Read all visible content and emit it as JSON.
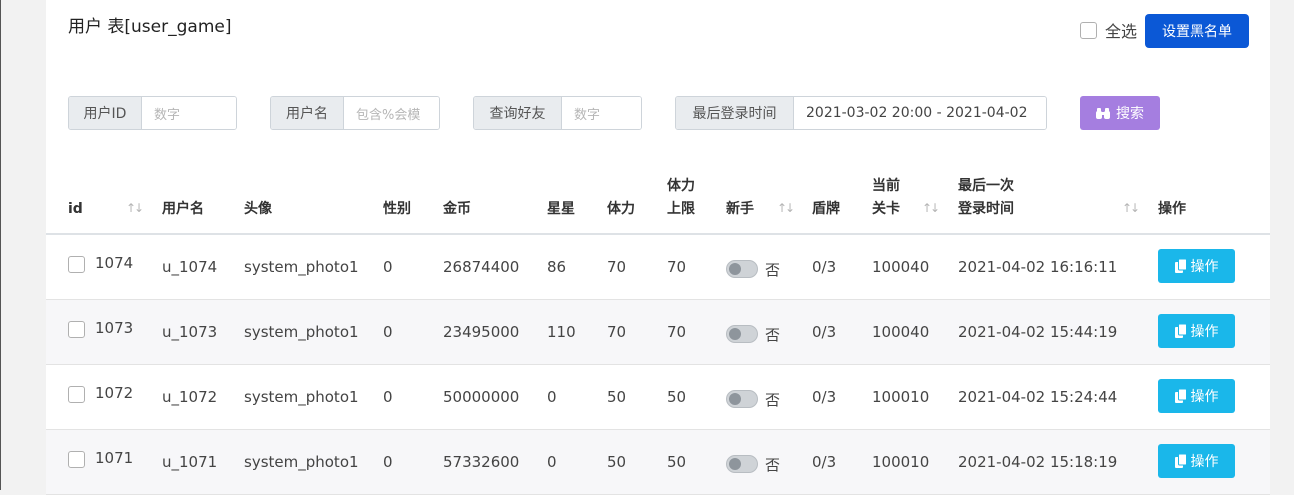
{
  "header": {
    "title": "用户 表[user_game]",
    "select_all_label": "全选",
    "blacklist_button": "设置黑名单"
  },
  "filters": {
    "user_id": {
      "label": "用户ID",
      "placeholder": "数字"
    },
    "username": {
      "label": "用户名",
      "placeholder": "包含%会模"
    },
    "friend": {
      "label": "查询好友",
      "placeholder": "数字"
    },
    "last_login": {
      "label": "最后登录时间",
      "value": "2021-03-02 20:00 - 2021-04-02"
    },
    "search_button": "搜索"
  },
  "table": {
    "headers": {
      "id": "id",
      "username": "用户名",
      "avatar": "头像",
      "gender": "性别",
      "gold": "金币",
      "stars": "星星",
      "stamina": "体力",
      "stamina_max_1": "体力",
      "stamina_max_2": "上限",
      "newbie": "新手",
      "shield": "盾牌",
      "level_1": "当前",
      "level_2": "关卡",
      "last_login_1": "最后一次",
      "last_login_2": "登录时间",
      "action": "操作"
    },
    "sort_glyph": "↑↓",
    "rows": [
      {
        "id": "1074",
        "username": "u_1074",
        "avatar": "system_photo1",
        "gender": "0",
        "gold": "26874400",
        "stars": "86",
        "stamina": "70",
        "stamina_max": "70",
        "newbie": "否",
        "shield": "0/3",
        "level": "100040",
        "last_login": "2021-04-02 16:16:11",
        "action": "操作"
      },
      {
        "id": "1073",
        "username": "u_1073",
        "avatar": "system_photo1",
        "gender": "0",
        "gold": "23495000",
        "stars": "110",
        "stamina": "70",
        "stamina_max": "70",
        "newbie": "否",
        "shield": "0/3",
        "level": "100040",
        "last_login": "2021-04-02 15:44:19",
        "action": "操作"
      },
      {
        "id": "1072",
        "username": "u_1072",
        "avatar": "system_photo1",
        "gender": "0",
        "gold": "50000000",
        "stars": "0",
        "stamina": "50",
        "stamina_max": "50",
        "newbie": "否",
        "shield": "0/3",
        "level": "100010",
        "last_login": "2021-04-02 15:24:44",
        "action": "操作"
      },
      {
        "id": "1071",
        "username": "u_1071",
        "avatar": "system_photo1",
        "gender": "0",
        "gold": "57332600",
        "stars": "0",
        "stamina": "50",
        "stamina_max": "50",
        "newbie": "否",
        "shield": "0/3",
        "level": "100010",
        "last_login": "2021-04-02 15:18:19",
        "action": "操作"
      }
    ]
  },
  "colors": {
    "blacklist_button": "#0b58d6",
    "search_button": "#a57ee0",
    "action_button": "#1ab7ea"
  },
  "icons": {
    "search": "binoculars-icon",
    "action": "copy-icon"
  }
}
